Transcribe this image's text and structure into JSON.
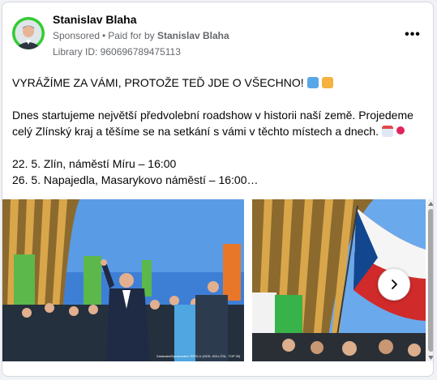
{
  "post": {
    "author": "Stanislav Blaha",
    "sponsored_label": "Sponsored",
    "separator": "•",
    "paid_for_label": "Paid for by",
    "paid_for_name": "Stanislav Blaha",
    "library_id": "Library ID: 960696789475113",
    "more_icon": "more-horizontal-icon",
    "text": {
      "headline": "VYRÁŽÍME ZA VÁMI, PROTOŽE TEĎ JDE O VŠECHNO!",
      "body": "Dnes startujeme největší předvolební roadshow v historii naší země. Projedeme celý Zlínský kraj a těšíme se na setkání s vámi v těchto místech a dnech.",
      "event_1": "22. 5. Zlín, náměstí Míru – 16:00",
      "event_2": "26. 5. Napajedla, Masarykovo náměstí – 16:00…"
    },
    "emoji_icons": [
      "map-emoji",
      "bus-emoji",
      "calendar-emoji",
      "pin-emoji"
    ]
  },
  "carousel": {
    "photo_1_caption": "Zadavatel/Zpracovatel: SPOLU (ODS, KDU-ČSL, TOP 09)",
    "next_icon": "chevron-right-icon"
  },
  "colors": {
    "avatar_ring": "#33cc33",
    "secondary_text": "#65676b",
    "card_border": "#d5d8dc"
  }
}
